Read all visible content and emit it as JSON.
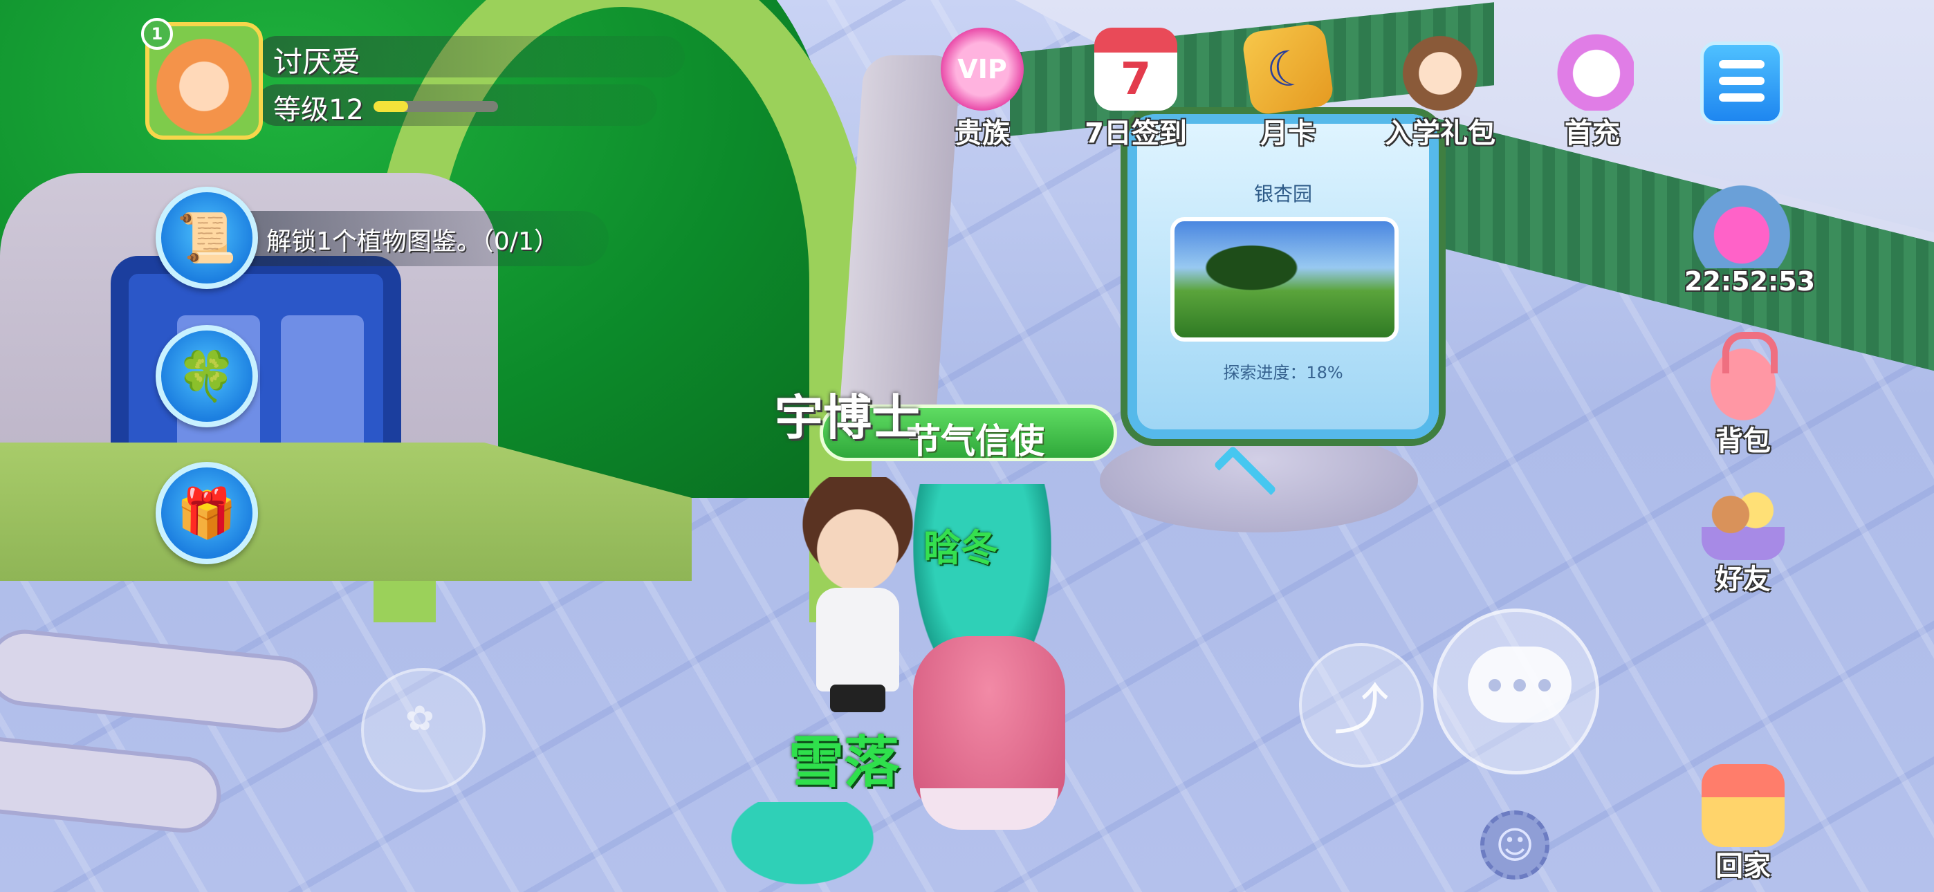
{
  "player": {
    "level_badge": "1",
    "name": "讨厌爱",
    "level_label": "等级12",
    "xp_fraction": 0.28
  },
  "quest": {
    "text": "解锁1个植物图鉴。（0/1）"
  },
  "top_menu": [
    {
      "label": "贵族",
      "icon": "vip-crown-icon"
    },
    {
      "label": "7日签到",
      "icon": "calendar-icon"
    },
    {
      "label": "月卡",
      "icon": "month-card-icon"
    },
    {
      "label": "入学礼包",
      "icon": "gift-pack-girl-icon"
    },
    {
      "label": "首充",
      "icon": "unicorn-icon"
    }
  ],
  "right_column": {
    "timer": "22:52:53",
    "items": [
      {
        "label": "背包",
        "icon": "backpack-icon"
      },
      {
        "label": "好友",
        "icon": "friends-icon"
      },
      {
        "label": "回家",
        "icon": "home-icon"
      }
    ]
  },
  "sign": {
    "title": "银杏园",
    "progress": "探索进度：18%"
  },
  "npc": {
    "dr_name": "宇博士",
    "dr_title": "节气信使",
    "girl_name": "晗冬",
    "player_char_name": "雪落"
  },
  "colors": {
    "hud_blue": "#1c7fe0",
    "name_green": "#2fe04c",
    "xp_yellow": "#f4e33a",
    "dome_green": "#0c8a2a"
  }
}
